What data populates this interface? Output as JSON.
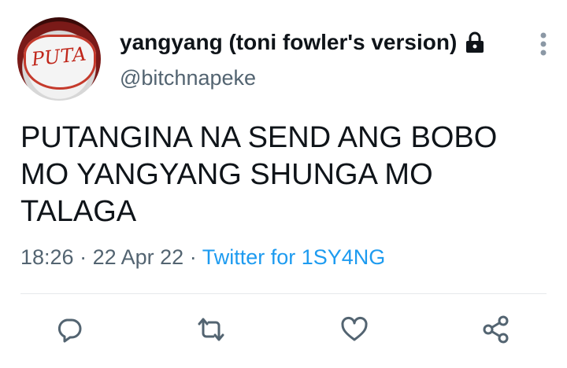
{
  "user": {
    "display_name": "yangyang (toni fowler's version)",
    "handle": "@bitchnapeke",
    "avatar_text": "PUTA",
    "protected_icon": "lock-icon"
  },
  "tweet": {
    "text_lines": [
      "PUTANGINA NA SEND ANG BOBO",
      "MO YANGYANG SHUNGA MO",
      "TALAGA"
    ],
    "time": "18:26",
    "separator": "·",
    "date": "22 Apr 22",
    "source": "Twitter for 1SY4NG"
  },
  "actions": [
    {
      "icon": "reply-icon"
    },
    {
      "icon": "retweet-icon"
    },
    {
      "icon": "like-icon"
    },
    {
      "icon": "share-icon"
    }
  ],
  "colors": {
    "text": "#0f1419",
    "secondary": "#536471",
    "link": "#1d9bf0",
    "divider": "#e6e9eb"
  }
}
